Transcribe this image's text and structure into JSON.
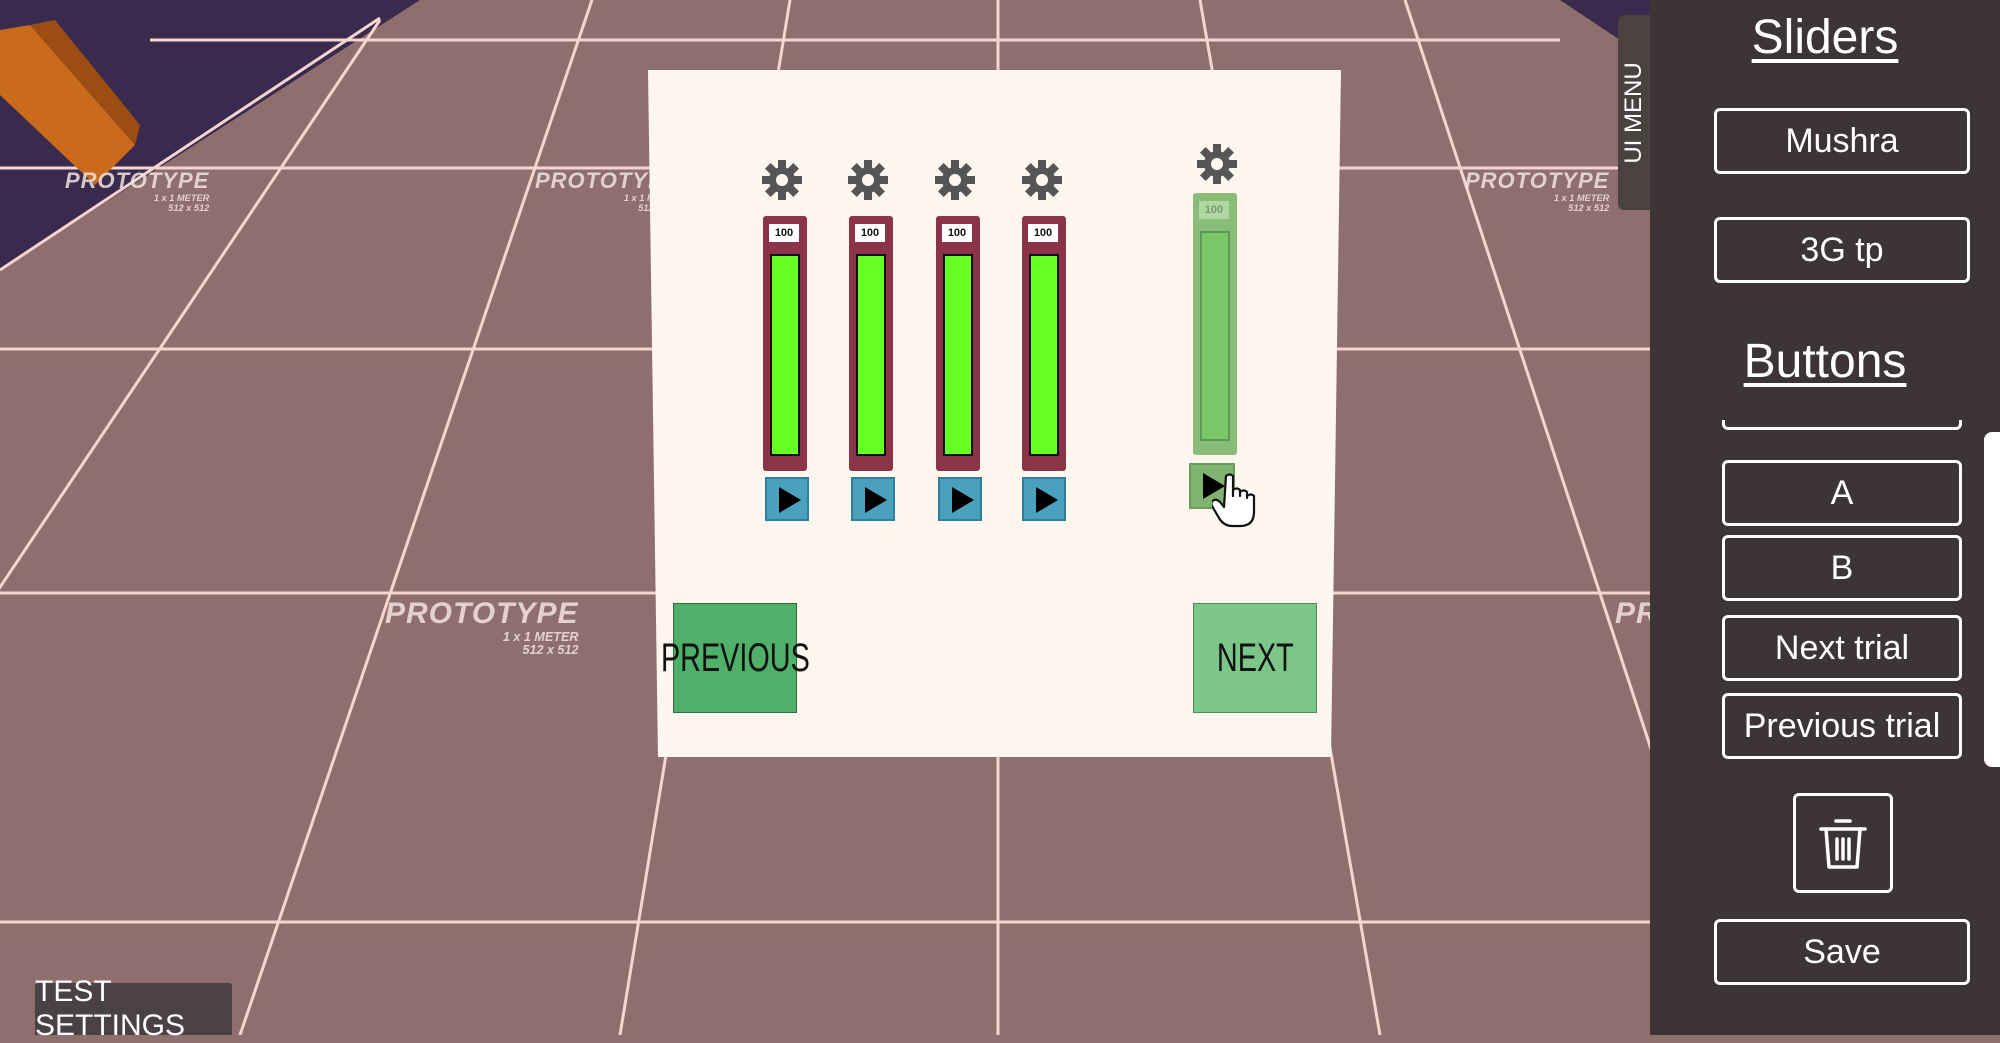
{
  "scene": {
    "watermark": {
      "title": "PROTOTYPE",
      "line1": "1 x 1 METER",
      "line2": "512 x 512"
    }
  },
  "test_panel": {
    "sliders": [
      {
        "value": "100",
        "level": 1.0
      },
      {
        "value": "100",
        "level": 1.0
      },
      {
        "value": "100",
        "level": 1.0
      },
      {
        "value": "100",
        "level": 1.0
      },
      {
        "value": "100",
        "level": 1.0
      }
    ],
    "previous_label": "PREVIOUS",
    "next_label": "NEXT"
  },
  "ui_menu": {
    "tab_label": "UI MENU",
    "sliders_heading": "Sliders",
    "slider_buttons": [
      "Mushra",
      "3G tp"
    ],
    "buttons_heading": "Buttons",
    "button_items": [
      "A",
      "B",
      "Next trial",
      "Previous trial"
    ],
    "save_label": "Save",
    "delete_icon": "trash-icon"
  },
  "bottom_bar": {
    "test_settings_label": "TEST SETTINGS"
  },
  "colors": {
    "floor": "#8f6f6d",
    "sky": "#3a2a4d",
    "grid_line": "#f5d5cf",
    "panel_bg": "#fdf6ee",
    "slider_frame": "#8b3447",
    "slider_fill": "#66ff22",
    "play_button": "#4aa0bd",
    "nav_button": "#4fb06a",
    "sidebar_bg": "#3d3535"
  }
}
